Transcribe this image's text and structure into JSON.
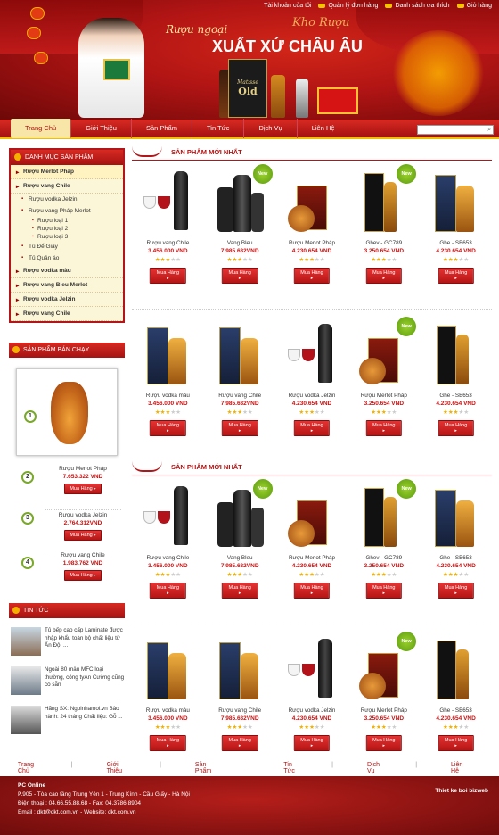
{
  "header": {
    "top_links": [
      "Tài khoản của tôi",
      "Quản lý đơn hàng",
      "Danh sách ưa thích",
      "Giỏ hàng"
    ],
    "logo": "Kho Rượu",
    "slogan_line1": "Rượu ngoại",
    "slogan_line2": "XUẤT XỨ CHÂU ÂU",
    "box_brand": "Matisse",
    "box_title": "Old"
  },
  "nav": {
    "items": [
      "Trang Chủ",
      "Giới Thiệu",
      "Sản Phẩm",
      "Tin Tức",
      "Dịch Vụ",
      "Liên Hệ"
    ],
    "active": 0
  },
  "search": {
    "placeholder": ""
  },
  "sidebar": {
    "category_title": "DANH MỤC SẢN PHẨM",
    "categories": [
      {
        "label": "Rượu Merlot Pháp",
        "type": "b sel"
      },
      {
        "label": "Rượu vang Chile",
        "type": "b"
      },
      {
        "label": "Rượu vodka Jelzin",
        "type": "sub"
      },
      {
        "label": "Rượu vang Pháp Merlot",
        "type": "sub"
      },
      {
        "label": "Rượu loại 1",
        "type": "subsub"
      },
      {
        "label": "Rượu loại 2",
        "type": "subsub"
      },
      {
        "label": "Rượu loại 3",
        "type": "subsub"
      },
      {
        "label": "Tủ Để Giầy",
        "type": "sub"
      },
      {
        "label": "Tủ Quần áo",
        "type": "sub"
      },
      {
        "label": "Rượu vodka màu",
        "type": "b"
      },
      {
        "label": "Rượu vang Bleu Merlot",
        "type": "b"
      },
      {
        "label": "Rượu vodka Jelzin",
        "type": "b"
      },
      {
        "label": "Rượu vang Chile",
        "type": "b"
      }
    ],
    "bestseller_title": "SẢN PHẨM BÁN CHẠY",
    "bestsellers": [
      {
        "num": "1"
      },
      {
        "num": "2",
        "name": "Rượu Merlot Pháp",
        "price": "7.653.322 VND"
      },
      {
        "num": "3",
        "name": "Rượu vodka Jelzin",
        "price": "2.764.312VND"
      },
      {
        "num": "4",
        "name": "Rượu vang Chile",
        "price": "1.983.762 VND"
      }
    ],
    "news_title": "TIN TỨC",
    "news": [
      "Tủ bếp cao cấp Laminate được nhập khẩu toàn bộ chất liệu từ Ấn Độ, ...",
      "Ngoài 80 mẫu MFC loại thường, công tyAn Cường cũng có sẵn",
      "Hãng SX: Ngoinhamoi.vn Bảo hành: 24 tháng Chất liệu: Gỗ ..."
    ]
  },
  "buy_label": "Mua Hàng",
  "new_badge": "New",
  "sections": [
    {
      "title": "SẢN PHẨM MỚI NHẤT",
      "rows": [
        [
          {
            "name": "Rượu vang Chile",
            "price": "3.456.000 VND",
            "stars": 3,
            "pic": "wine",
            "new": false
          },
          {
            "name": "Vang Bleu",
            "price": "7.985.632VND",
            "stars": 3,
            "pic": "dark",
            "new": true
          },
          {
            "name": "Rượu Merlot Pháp",
            "price": "4.230.654 VND",
            "stars": 3,
            "pic": "cognac",
            "new": false
          },
          {
            "name": "Ghev - GC789",
            "price": "3.250.654 VND",
            "stars": 3,
            "pic": "tall",
            "new": true
          },
          {
            "name": "Ghe - SB653",
            "price": "4.230.654 VND",
            "stars": 3,
            "pic": "regal",
            "new": false
          }
        ],
        [
          {
            "name": "Rượu vodka màu",
            "price": "3.456.000 VND",
            "stars": 3,
            "pic": "regal2",
            "new": false
          },
          {
            "name": "Rượu vang Chile",
            "price": "7.985.632VND",
            "stars": 3,
            "pic": "regal3",
            "new": false
          },
          {
            "name": "Rượu vodka Jelzin",
            "price": "4.230.654 VND",
            "stars": 3,
            "pic": "wine",
            "new": false
          },
          {
            "name": "Rượu Merlot Pháp",
            "price": "3.250.654 VND",
            "stars": 3,
            "pic": "cognac",
            "new": true
          },
          {
            "name": "Ghe - SB653",
            "price": "4.230.654 VND",
            "stars": 3,
            "pic": "tall2",
            "new": false
          }
        ]
      ]
    },
    {
      "title": "SẢN PHẨM MỚI NHẤT",
      "rows": [
        [
          {
            "name": "Rượu vang Chile",
            "price": "3.456.000 VND",
            "stars": 3,
            "pic": "wine",
            "new": false
          },
          {
            "name": "Vang Bleu",
            "price": "7.985.632VND",
            "stars": 3,
            "pic": "dark",
            "new": true
          },
          {
            "name": "Rượu Merlot Pháp",
            "price": "4.230.654 VND",
            "stars": 3,
            "pic": "cognac",
            "new": false
          },
          {
            "name": "Ghev - GC789",
            "price": "3.250.654 VND",
            "stars": 3,
            "pic": "tall",
            "new": true
          },
          {
            "name": "Ghe - SB653",
            "price": "4.230.654 VND",
            "stars": 3,
            "pic": "regal",
            "new": false
          }
        ],
        [
          {
            "name": "Rượu vodka màu",
            "price": "3.456.000 VND",
            "stars": 3,
            "pic": "regal2",
            "new": false
          },
          {
            "name": "Rượu vang Chile",
            "price": "7.985.632VND",
            "stars": 3,
            "pic": "regal3",
            "new": false
          },
          {
            "name": "Rượu vodka Jelzin",
            "price": "4.230.654 VND",
            "stars": 3,
            "pic": "wine",
            "new": false
          },
          {
            "name": "Rượu Merlot Pháp",
            "price": "3.250.654 VND",
            "stars": 3,
            "pic": "cognac",
            "new": true
          },
          {
            "name": "Ghe - SB653",
            "price": "4.230.654 VND",
            "stars": 3,
            "pic": "tall2",
            "new": false
          }
        ]
      ]
    }
  ],
  "footer": {
    "links": [
      "Trang Chủ",
      "Giới Thiệu",
      "Sản Phẩm",
      "Tin Tức",
      "Dịch Vụ",
      "Liên Hệ"
    ],
    "company": "PC Online",
    "address": "P.905 - Tòa cao tầng Trung Yên 1 - Trung Kính - Cầu Giấy - Hà Nội",
    "phone": "Điện thoại : 04.66.55.88.68 - Fax: 04.3786.8904",
    "email": "Email : dkt@dkt.com.vn  -  Website: dkt.com.vn",
    "credit": "Thiet ke boi bizweb"
  }
}
